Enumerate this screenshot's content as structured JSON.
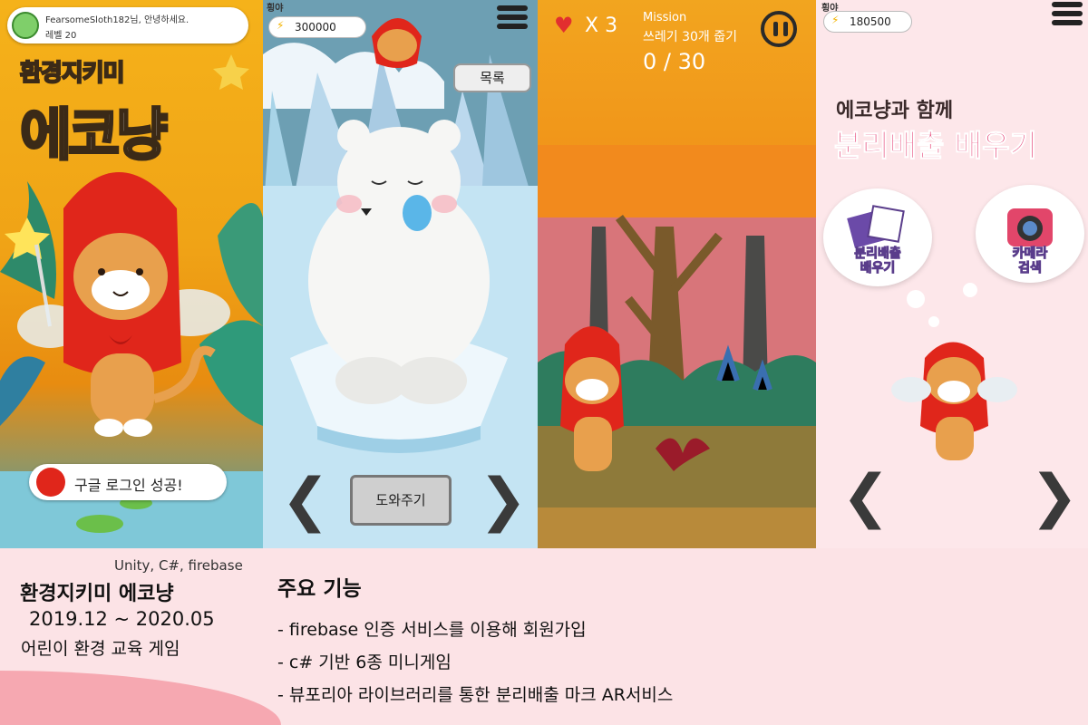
{
  "panel1": {
    "login_greeting": "FearsomeSloth182님, 안녕하세요.",
    "login_level": "레벨 20",
    "title_small": "환경지키미",
    "title_big": "에코냥",
    "toast": "구글 로그인 성공!"
  },
  "panel2": {
    "label": "횡야",
    "coins": "300000",
    "list_button": "목록",
    "help_button": "도와주기",
    "prev_icon": "chevron-left-icon",
    "next_icon": "chevron-right-icon"
  },
  "panel3": {
    "lives": "X 3",
    "mission_label": "Mission",
    "mission_text": "쓰레기 30개 줍기",
    "mission_progress": "0 / 30"
  },
  "panel4": {
    "label": "횡야",
    "coins": "180500",
    "subtitle": "에코냥과 함께",
    "title": "분리배출 배우기",
    "cloud1": "분리배출\n배우기",
    "cloud2": "카메라\n검색"
  },
  "footer": {
    "tech": "Unity, C#, firebase",
    "title": "환경지키미 에코냥",
    "date": "2019.12 ~ 2020.05",
    "desc": "어린이 환경 교육 게임",
    "features_heading": "주요 기능",
    "features": [
      "- firebase 인증 서비스를 이용해 회원가입",
      "- c# 기반 6종 미니게임",
      "- 뷰포리아 라이브러리를 통한 분리배출 마크 AR서비스"
    ]
  },
  "colors": {
    "footer_bg": "#fce3e6",
    "accent_pink": "#e22a64",
    "hood_red": "#e0261b"
  }
}
